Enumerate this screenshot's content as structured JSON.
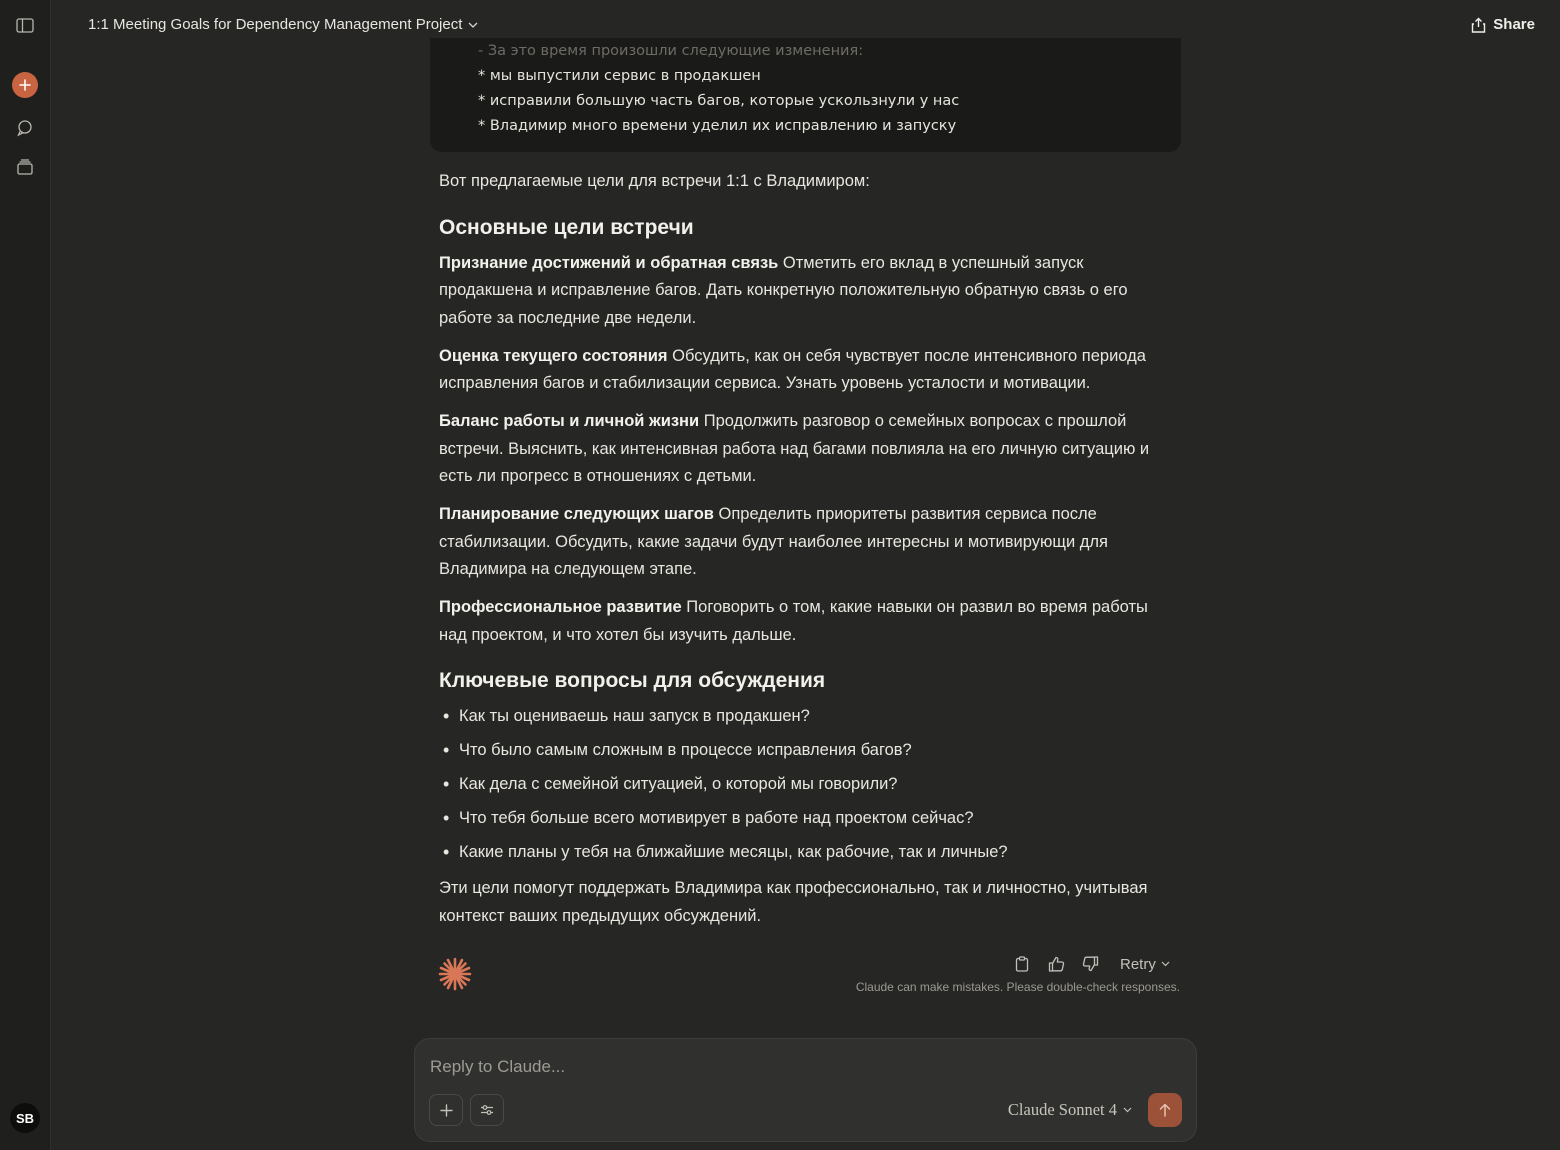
{
  "sidebar": {
    "avatar_initials": "SB"
  },
  "header": {
    "title": "1:1 Meeting Goals for Dependency Management Project",
    "share_label": "Share"
  },
  "code_block": {
    "lines": [
      "- За это время произошли следующие изменения:",
      "* мы выпустили сервис в продакшен",
      "* исправили большую часть багов, которые ускользнули у нас",
      "* Владимир много времени уделил их исправлению и запуску"
    ]
  },
  "response": {
    "intro": "Вот предлагаемые цели для встречи 1:1 с Владимиром:",
    "heading_goals": "Основные цели встречи",
    "goals": [
      {
        "title": "Признание достижений и обратная связь",
        "text": " Отметить его вклад в успешный запуск продакшена и исправление багов. Дать конкретную положительную обратную связь о его работе за последние две недели."
      },
      {
        "title": "Оценка текущего состояния",
        "text": " Обсудить, как он себя чувствует после интенсивного периода исправления багов и стабилизации сервиса. Узнать уровень усталости и мотивации."
      },
      {
        "title": "Баланс работы и личной жизни",
        "text": " Продолжить разговор о семейных вопросах с прошлой встречи. Выяснить, как интенсивная работа над багами повлияла на его личную ситуацию и есть ли прогресс в отношениях с детьми."
      },
      {
        "title": "Планирование следующих шагов",
        "text": " Определить приоритеты развития сервиса после стабилизации. Обсудить, какие задачи будут наиболее интересны и мотивирующи для Владимира на следующем этапе."
      },
      {
        "title": "Профессиональное развитие",
        "text": " Поговорить о том, какие навыки он развил во время работы над проектом, и что хотел бы изучить дальше."
      }
    ],
    "heading_questions": "Ключевые вопросы для обсуждения",
    "questions": [
      "Как ты оцениваешь наш запуск в продакшен?",
      "Что было самым сложным в процессе исправления багов?",
      "Как дела с семейной ситуацией, о которой мы говорили?",
      "Что тебя больше всего мотивирует в работе над проектом сейчас?",
      "Какие планы у тебя на ближайшие месяцы, как рабочие, так и личные?"
    ],
    "closing": "Эти цели помогут поддержать Владимира как профессионально, так и личностно, учитывая контекст ваших предыдущих обсуждений."
  },
  "message_actions": {
    "retry_label": "Retry",
    "disclaimer": "Claude can make mistakes. Please double-check responses."
  },
  "composer": {
    "placeholder": "Reply to Claude...",
    "model_label": "Claude Sonnet 4"
  },
  "colors": {
    "background": "#262624",
    "sidebar": "#1f1f1d",
    "accent": "#c96442",
    "send_button": "#9c5139"
  }
}
